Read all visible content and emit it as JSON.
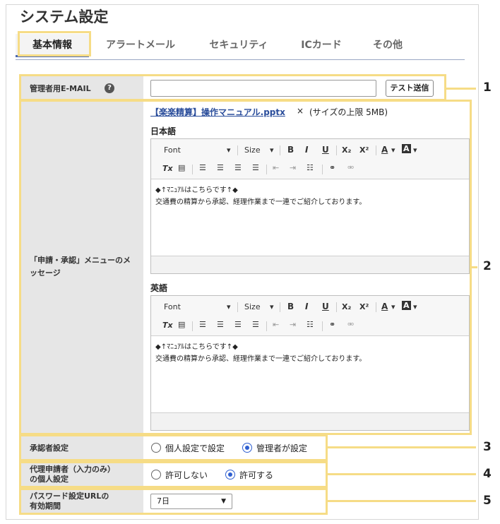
{
  "page_title": "システム設定",
  "tabs": [
    "基本情報",
    "アラートメール",
    "セキュリティ",
    "ICカード",
    "その他"
  ],
  "rows": {
    "email": {
      "label": "管理者用E-MAIL",
      "help": "?",
      "value": "",
      "test_button": "テスト送信"
    },
    "message": {
      "label": "「申請・承認」メニューのメッセージ",
      "attachment_link": "【楽楽精算】操作マニュアル.pptx",
      "attachment_remove": "×",
      "attachment_note": "(サイズの上限 5MB)",
      "editors": [
        {
          "heading": "日本語",
          "lines": [
            "◆↑ﾏﾆｭｱﾙはこちらです↑◆",
            "交通費の精算から承認、経理作業まで一連でご紹介しております。"
          ]
        },
        {
          "heading": "英語",
          "lines": [
            "◆↑ﾏﾆｭｱﾙはこちらです↑◆",
            "交通費の精算から承認、経理作業まで一連でご紹介しております。"
          ]
        }
      ],
      "toolbar": {
        "font": "Font",
        "size": "Size",
        "bold": "B",
        "italic": "I",
        "underline": "U",
        "subscript": "X₂",
        "superscript": "X²",
        "text_color": "A",
        "bg_color": "A",
        "clear_format": "Tx"
      }
    },
    "approver": {
      "label": "承認者設定",
      "options": [
        "個人設定で設定",
        "管理者が設定"
      ],
      "selected": 1
    },
    "proxy": {
      "label": "代理申請者（入力のみ）の個人設定",
      "options": [
        "許可しない",
        "許可する"
      ],
      "selected": 1
    },
    "password_url": {
      "label": "パスワード設定URLの有効期間",
      "value": "7日"
    }
  },
  "callouts": [
    "1",
    "2",
    "3",
    "4",
    "5"
  ],
  "colors": {
    "highlight": "#f6dc86",
    "accent": "#4a67b0",
    "label_bg": "#e6e6e6",
    "radio": "#2f5fd0"
  }
}
